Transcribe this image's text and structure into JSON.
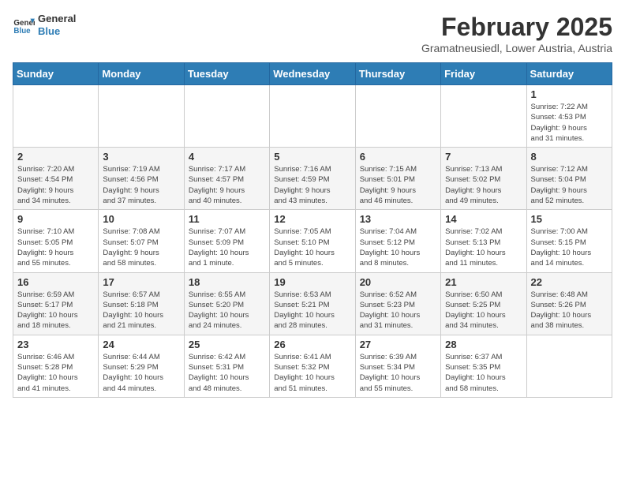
{
  "header": {
    "logo_line1": "General",
    "logo_line2": "Blue",
    "month_title": "February 2025",
    "location": "Gramatneusiedl, Lower Austria, Austria"
  },
  "weekdays": [
    "Sunday",
    "Monday",
    "Tuesday",
    "Wednesday",
    "Thursday",
    "Friday",
    "Saturday"
  ],
  "weeks": [
    [
      {
        "day": "",
        "info": ""
      },
      {
        "day": "",
        "info": ""
      },
      {
        "day": "",
        "info": ""
      },
      {
        "day": "",
        "info": ""
      },
      {
        "day": "",
        "info": ""
      },
      {
        "day": "",
        "info": ""
      },
      {
        "day": "1",
        "info": "Sunrise: 7:22 AM\nSunset: 4:53 PM\nDaylight: 9 hours\nand 31 minutes."
      }
    ],
    [
      {
        "day": "2",
        "info": "Sunrise: 7:20 AM\nSunset: 4:54 PM\nDaylight: 9 hours\nand 34 minutes."
      },
      {
        "day": "3",
        "info": "Sunrise: 7:19 AM\nSunset: 4:56 PM\nDaylight: 9 hours\nand 37 minutes."
      },
      {
        "day": "4",
        "info": "Sunrise: 7:17 AM\nSunset: 4:57 PM\nDaylight: 9 hours\nand 40 minutes."
      },
      {
        "day": "5",
        "info": "Sunrise: 7:16 AM\nSunset: 4:59 PM\nDaylight: 9 hours\nand 43 minutes."
      },
      {
        "day": "6",
        "info": "Sunrise: 7:15 AM\nSunset: 5:01 PM\nDaylight: 9 hours\nand 46 minutes."
      },
      {
        "day": "7",
        "info": "Sunrise: 7:13 AM\nSunset: 5:02 PM\nDaylight: 9 hours\nand 49 minutes."
      },
      {
        "day": "8",
        "info": "Sunrise: 7:12 AM\nSunset: 5:04 PM\nDaylight: 9 hours\nand 52 minutes."
      }
    ],
    [
      {
        "day": "9",
        "info": "Sunrise: 7:10 AM\nSunset: 5:05 PM\nDaylight: 9 hours\nand 55 minutes."
      },
      {
        "day": "10",
        "info": "Sunrise: 7:08 AM\nSunset: 5:07 PM\nDaylight: 9 hours\nand 58 minutes."
      },
      {
        "day": "11",
        "info": "Sunrise: 7:07 AM\nSunset: 5:09 PM\nDaylight: 10 hours\nand 1 minute."
      },
      {
        "day": "12",
        "info": "Sunrise: 7:05 AM\nSunset: 5:10 PM\nDaylight: 10 hours\nand 5 minutes."
      },
      {
        "day": "13",
        "info": "Sunrise: 7:04 AM\nSunset: 5:12 PM\nDaylight: 10 hours\nand 8 minutes."
      },
      {
        "day": "14",
        "info": "Sunrise: 7:02 AM\nSunset: 5:13 PM\nDaylight: 10 hours\nand 11 minutes."
      },
      {
        "day": "15",
        "info": "Sunrise: 7:00 AM\nSunset: 5:15 PM\nDaylight: 10 hours\nand 14 minutes."
      }
    ],
    [
      {
        "day": "16",
        "info": "Sunrise: 6:59 AM\nSunset: 5:17 PM\nDaylight: 10 hours\nand 18 minutes."
      },
      {
        "day": "17",
        "info": "Sunrise: 6:57 AM\nSunset: 5:18 PM\nDaylight: 10 hours\nand 21 minutes."
      },
      {
        "day": "18",
        "info": "Sunrise: 6:55 AM\nSunset: 5:20 PM\nDaylight: 10 hours\nand 24 minutes."
      },
      {
        "day": "19",
        "info": "Sunrise: 6:53 AM\nSunset: 5:21 PM\nDaylight: 10 hours\nand 28 minutes."
      },
      {
        "day": "20",
        "info": "Sunrise: 6:52 AM\nSunset: 5:23 PM\nDaylight: 10 hours\nand 31 minutes."
      },
      {
        "day": "21",
        "info": "Sunrise: 6:50 AM\nSunset: 5:25 PM\nDaylight: 10 hours\nand 34 minutes."
      },
      {
        "day": "22",
        "info": "Sunrise: 6:48 AM\nSunset: 5:26 PM\nDaylight: 10 hours\nand 38 minutes."
      }
    ],
    [
      {
        "day": "23",
        "info": "Sunrise: 6:46 AM\nSunset: 5:28 PM\nDaylight: 10 hours\nand 41 minutes."
      },
      {
        "day": "24",
        "info": "Sunrise: 6:44 AM\nSunset: 5:29 PM\nDaylight: 10 hours\nand 44 minutes."
      },
      {
        "day": "25",
        "info": "Sunrise: 6:42 AM\nSunset: 5:31 PM\nDaylight: 10 hours\nand 48 minutes."
      },
      {
        "day": "26",
        "info": "Sunrise: 6:41 AM\nSunset: 5:32 PM\nDaylight: 10 hours\nand 51 minutes."
      },
      {
        "day": "27",
        "info": "Sunrise: 6:39 AM\nSunset: 5:34 PM\nDaylight: 10 hours\nand 55 minutes."
      },
      {
        "day": "28",
        "info": "Sunrise: 6:37 AM\nSunset: 5:35 PM\nDaylight: 10 hours\nand 58 minutes."
      },
      {
        "day": "",
        "info": ""
      }
    ]
  ]
}
